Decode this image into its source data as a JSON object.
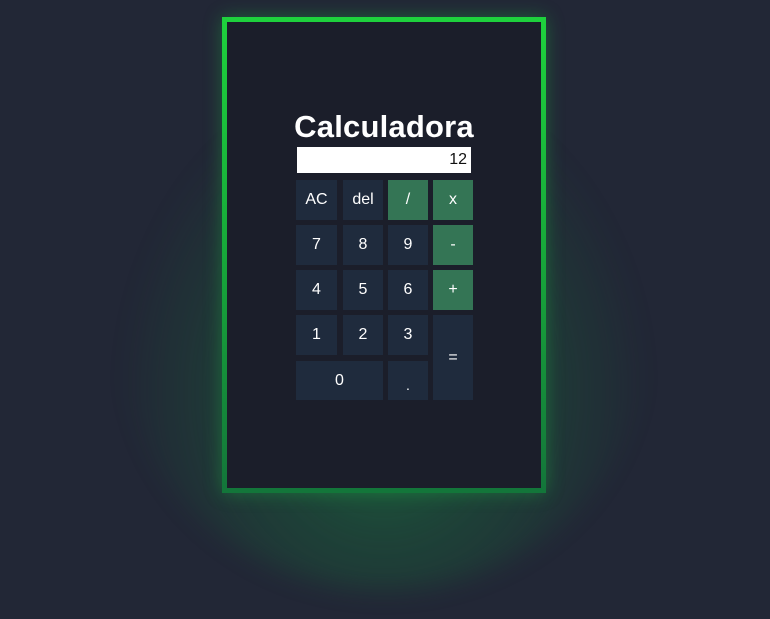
{
  "calculator": {
    "title": "Calculadora",
    "display_value": "12",
    "buttons": {
      "ac": "AC",
      "del": "del",
      "divide": "/",
      "multiply": "x",
      "seven": "7",
      "eight": "8",
      "nine": "9",
      "minus": "-",
      "four": "4",
      "five": "5",
      "six": "6",
      "plus": "+",
      "one": "1",
      "two": "2",
      "three": "3",
      "equals": "=",
      "zero": "0",
      "dot": "."
    }
  },
  "colors": {
    "background": "#222736",
    "card": "#1b1e2a",
    "border_accent": "#1ed13d",
    "button": "#1f2b3d",
    "operator_button": "#347555"
  }
}
